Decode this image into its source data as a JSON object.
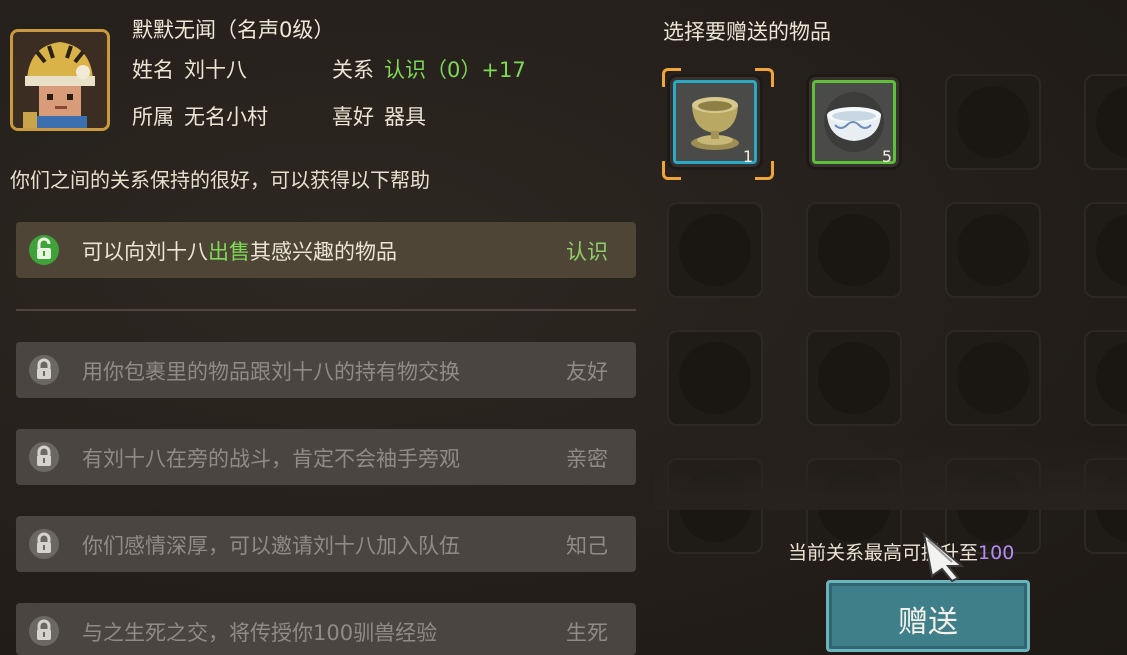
{
  "npc": {
    "title": "默默无闻（名声0级）",
    "name_label": "姓名",
    "name_value": "刘十八",
    "relation_label": "关系",
    "relation_value": "认识（0）+17",
    "affiliation_label": "所属",
    "affiliation_value": "无名小村",
    "hobby_label": "喜好",
    "hobby_value": "器具"
  },
  "help_text": "你们之间的关系保持的很好，可以获得以下帮助",
  "perks": [
    {
      "pre": "可以向刘十八",
      "hl": "出售",
      "post": "其感兴趣的物品",
      "rank": "认识",
      "unlocked": true
    },
    {
      "pre": "用你包裹里的物品跟刘十八的持有物交换",
      "hl": "",
      "post": "",
      "rank": "友好",
      "unlocked": false
    },
    {
      "pre": "有刘十八在旁的战斗，肯定不会袖手旁观",
      "hl": "",
      "post": "",
      "rank": "亲密",
      "unlocked": false
    },
    {
      "pre": "你们感情深厚，可以邀请刘十八加入队伍",
      "hl": "",
      "post": "",
      "rank": "知己",
      "unlocked": false
    },
    {
      "pre": "与之生死之交，将传授你100驯兽经验",
      "hl": "",
      "post": "",
      "rank": "生死",
      "unlocked": false
    }
  ],
  "gift_panel": {
    "title": "选择要赠送的物品",
    "items": [
      {
        "icon": "bronze-cup-icon",
        "count": "1",
        "rarity_color": "#2aa8c4",
        "selected": true
      },
      {
        "icon": "porcelain-bowl-icon",
        "count": "5",
        "rarity_color": "#5fbf3a",
        "selected": false
      }
    ],
    "max_note_prefix": "当前关系最高可提升至",
    "max_value": "100",
    "give_button": "赠送"
  }
}
